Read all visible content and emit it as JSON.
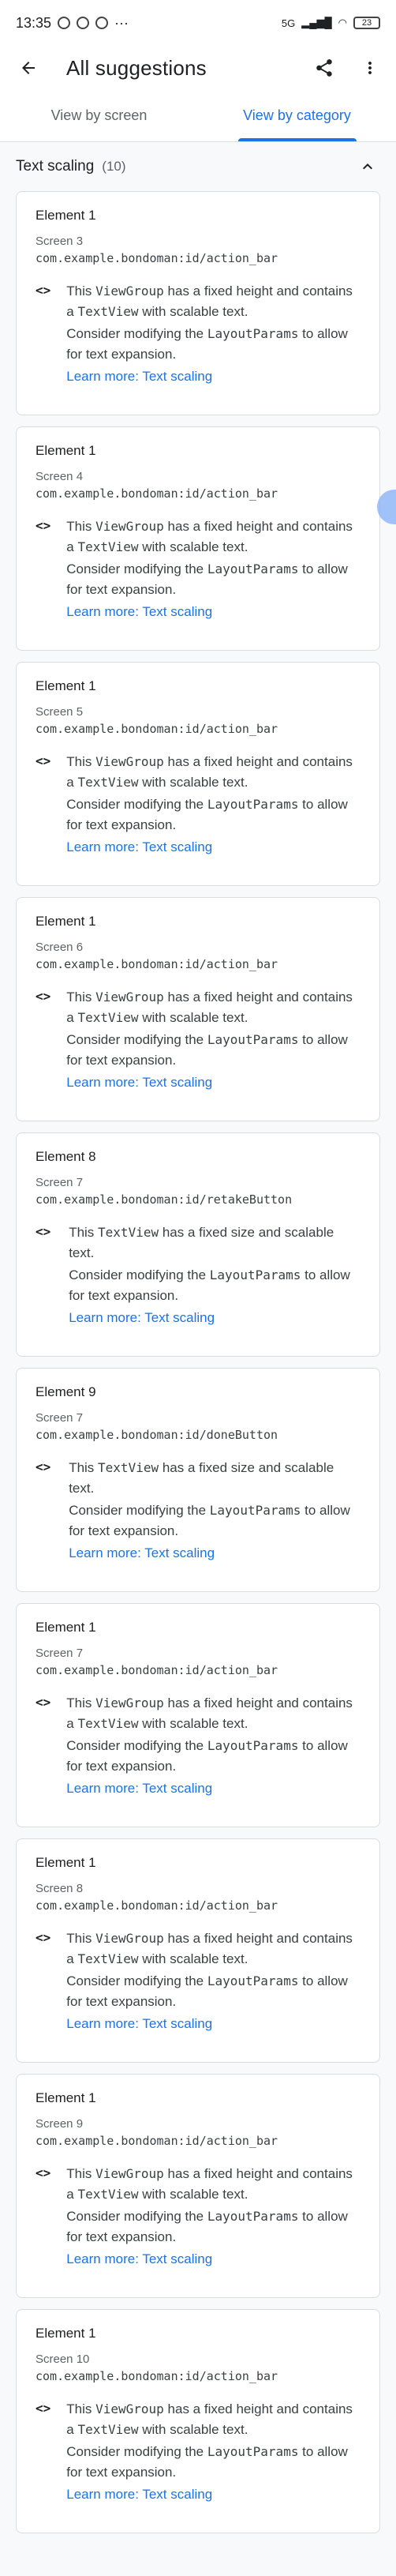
{
  "status_bar": {
    "time": "13:35",
    "network": "5G",
    "battery": "23"
  },
  "app_bar": {
    "title": "All suggestions"
  },
  "tabs": [
    {
      "label": "View by screen"
    },
    {
      "label": "View by category"
    }
  ],
  "section": {
    "title": "Text scaling",
    "count": "(10)"
  },
  "cards": [
    {
      "element": "Element 1",
      "screen": "Screen 3",
      "id": "com.example.bondoman:id/action_bar",
      "desc_pre": "This ",
      "widget": "ViewGroup",
      "desc_mid": " has a fixed height and contains a ",
      "desc_widget2": "TextView",
      "desc_post": " with scalable text.",
      "consider_pre": "Consider modifying the ",
      "consider_code": "LayoutParams",
      "consider_post": " to allow for text expansion.",
      "learn": "Learn more: Text scaling"
    },
    {
      "element": "Element 1",
      "screen": "Screen 4",
      "id": "com.example.bondoman:id/action_bar",
      "desc_pre": "This ",
      "widget": "ViewGroup",
      "desc_mid": " has a fixed height and contains a ",
      "desc_widget2": "TextView",
      "desc_post": " with scalable text.",
      "consider_pre": "Consider modifying the ",
      "consider_code": "LayoutParams",
      "consider_post": " to allow for text expansion.",
      "learn": "Learn more: Text scaling"
    },
    {
      "element": "Element 1",
      "screen": "Screen 5",
      "id": "com.example.bondoman:id/action_bar",
      "desc_pre": "This ",
      "widget": "ViewGroup",
      "desc_mid": " has a fixed height and contains a ",
      "desc_widget2": "TextView",
      "desc_post": " with scalable text.",
      "consider_pre": "Consider modifying the ",
      "consider_code": "LayoutParams",
      "consider_post": " to allow for text expansion.",
      "learn": "Learn more: Text scaling"
    },
    {
      "element": "Element 1",
      "screen": "Screen 6",
      "id": "com.example.bondoman:id/action_bar",
      "desc_pre": "This ",
      "widget": "ViewGroup",
      "desc_mid": " has a fixed height and contains a ",
      "desc_widget2": "TextView",
      "desc_post": " with scalable text.",
      "consider_pre": "Consider modifying the ",
      "consider_code": "LayoutParams",
      "consider_post": " to allow for text expansion.",
      "learn": "Learn more: Text scaling"
    },
    {
      "element": "Element 8",
      "screen": "Screen 7",
      "id": "com.example.bondoman:id/retakeButton",
      "desc_pre": "This ",
      "widget": "TextView",
      "desc_mid": " has a fixed size and scalable text.",
      "desc_widget2": "",
      "desc_post": "",
      "consider_pre": "Consider modifying the ",
      "consider_code": "LayoutParams",
      "consider_post": " to allow for text expansion.",
      "learn": "Learn more: Text scaling"
    },
    {
      "element": "Element 9",
      "screen": "Screen 7",
      "id": "com.example.bondoman:id/doneButton",
      "desc_pre": "This ",
      "widget": "TextView",
      "desc_mid": " has a fixed size and scalable text.",
      "desc_widget2": "",
      "desc_post": "",
      "consider_pre": "Consider modifying the ",
      "consider_code": "LayoutParams",
      "consider_post": " to allow for text expansion.",
      "learn": "Learn more: Text scaling"
    },
    {
      "element": "Element 1",
      "screen": "Screen 7",
      "id": "com.example.bondoman:id/action_bar",
      "desc_pre": "This ",
      "widget": "ViewGroup",
      "desc_mid": " has a fixed height and contains a ",
      "desc_widget2": "TextView",
      "desc_post": " with scalable text.",
      "consider_pre": "Consider modifying the ",
      "consider_code": "LayoutParams",
      "consider_post": " to allow for text expansion.",
      "learn": "Learn more: Text scaling"
    },
    {
      "element": "Element 1",
      "screen": "Screen 8",
      "id": "com.example.bondoman:id/action_bar",
      "desc_pre": "This ",
      "widget": "ViewGroup",
      "desc_mid": " has a fixed height and contains a ",
      "desc_widget2": "TextView",
      "desc_post": " with scalable text.",
      "consider_pre": "Consider modifying the ",
      "consider_code": "LayoutParams",
      "consider_post": " to allow for text expansion.",
      "learn": "Learn more: Text scaling"
    },
    {
      "element": "Element 1",
      "screen": "Screen 9",
      "id": "com.example.bondoman:id/action_bar",
      "desc_pre": "This ",
      "widget": "ViewGroup",
      "desc_mid": " has a fixed height and contains a ",
      "desc_widget2": "TextView",
      "desc_post": " with scalable text.",
      "consider_pre": "Consider modifying the ",
      "consider_code": "LayoutParams",
      "consider_post": " to allow for text expansion.",
      "learn": "Learn more: Text scaling"
    },
    {
      "element": "Element 1",
      "screen": "Screen 10",
      "id": "com.example.bondoman:id/action_bar",
      "desc_pre": "This ",
      "widget": "ViewGroup",
      "desc_mid": " has a fixed height and contains a ",
      "desc_widget2": "TextView",
      "desc_post": " with scalable text.",
      "consider_pre": "Consider modifying the ",
      "consider_code": "LayoutParams",
      "consider_post": " to allow for text expansion.",
      "learn": "Learn more: Text scaling"
    }
  ],
  "icons": {
    "back": "arrow-left-icon",
    "share": "share-icon",
    "more": "more-vert-icon",
    "collapse": "chevron-up-icon",
    "code": "code-icon"
  }
}
